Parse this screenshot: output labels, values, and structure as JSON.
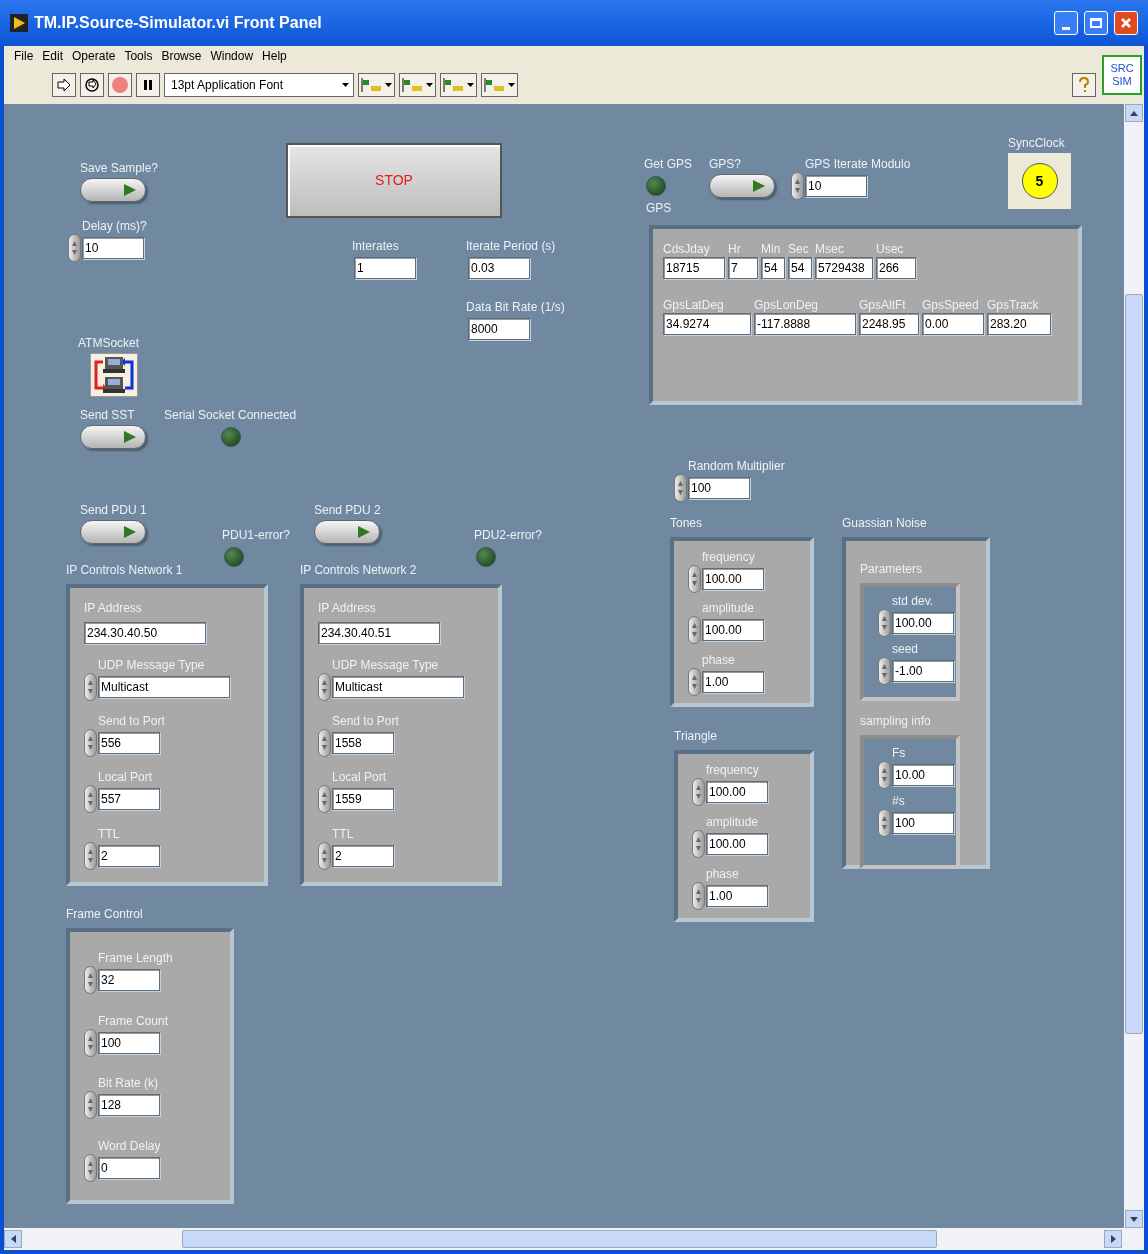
{
  "window": {
    "title": "TM.IP.Source-Simulator.vi Front Panel"
  },
  "menu": [
    "File",
    "Edit",
    "Operate",
    "Tools",
    "Browse",
    "Window",
    "Help"
  ],
  "toolbar": {
    "font": "13pt Application Font"
  },
  "vi_icon": [
    "SRC",
    "SIM"
  ],
  "controls": [
    {
      "kind": "switch",
      "label": "Save Sample?",
      "on": true
    },
    {
      "kind": "button",
      "label": "STOP"
    },
    {
      "kind": "numeric",
      "label": "Delay (ms)?",
      "value": "10"
    },
    {
      "kind": "indicator",
      "label": "Interates",
      "value": "1"
    },
    {
      "kind": "indicator",
      "label": "Iterate Period (s)",
      "value": "0.03"
    },
    {
      "kind": "indicator",
      "label": "Data Bit Rate (1/s)",
      "value": "8000"
    },
    {
      "kind": "socket",
      "label": "ATMSocket"
    },
    {
      "kind": "switch",
      "label": "Send SST",
      "on": true
    },
    {
      "kind": "led",
      "label": "Serial Socket Connected",
      "on": false
    },
    {
      "kind": "switch",
      "label": "Send PDU 1",
      "on": true
    },
    {
      "kind": "led",
      "label": "PDU1-error?",
      "on": false
    },
    {
      "kind": "switch",
      "label": "Send PDU 2",
      "on": true
    },
    {
      "kind": "led",
      "label": "PDU2-error?",
      "on": false
    },
    {
      "kind": "cluster",
      "label": "IP Controls Network 1",
      "children": [
        {
          "kind": "string",
          "label": "IP Address",
          "value": "234.30.40.50"
        },
        {
          "kind": "enum",
          "label": "UDP Message Type",
          "value": "Multicast"
        },
        {
          "kind": "numeric",
          "label": "Send to Port",
          "value": "556"
        },
        {
          "kind": "numeric",
          "label": "Local Port",
          "value": "557"
        },
        {
          "kind": "numeric",
          "label": "TTL",
          "value": "2"
        }
      ]
    },
    {
      "kind": "cluster",
      "label": "IP Controls Network 2",
      "children": [
        {
          "kind": "string",
          "label": "IP Address",
          "value": "234.30.40.51"
        },
        {
          "kind": "enum",
          "label": "UDP Message Type",
          "value": "Multicast"
        },
        {
          "kind": "numeric",
          "label": "Send to Port",
          "value": "1558"
        },
        {
          "kind": "numeric",
          "label": "Local Port",
          "value": "1559"
        },
        {
          "kind": "numeric",
          "label": "TTL",
          "value": "2"
        }
      ]
    },
    {
      "kind": "cluster",
      "label": "Frame Control",
      "children": [
        {
          "kind": "numeric",
          "label": "Frame Length",
          "value": "32"
        },
        {
          "kind": "numeric",
          "label": "Frame Count",
          "value": "100"
        },
        {
          "kind": "numeric",
          "label": "Bit Rate (k)",
          "value": "128"
        },
        {
          "kind": "numeric",
          "label": "Word Delay",
          "value": "0"
        }
      ]
    },
    {
      "kind": "led",
      "label": "Get GPS",
      "caption": "GPS",
      "on": false
    },
    {
      "kind": "switch",
      "label": "GPS?",
      "on": true
    },
    {
      "kind": "numeric",
      "label": "GPS Iterate Modulo",
      "value": "10"
    },
    {
      "kind": "clock",
      "label": "SyncClock",
      "value": "5"
    },
    {
      "kind": "cluster",
      "time_fields": [
        {
          "label": "CdsJday",
          "value": "18715"
        },
        {
          "label": "Hr",
          "value": "7"
        },
        {
          "label": "Min",
          "value": "54"
        },
        {
          "label": "Sec",
          "value": "54"
        },
        {
          "label": "Msec",
          "value": "5729438"
        },
        {
          "label": "Usec",
          "value": "266"
        }
      ],
      "position_fields": [
        {
          "label": "GpsLatDeg",
          "value": "34.9274"
        },
        {
          "label": "GpsLonDeg",
          "value": "-117.8888"
        },
        {
          "label": "GpsAltFt",
          "value": "2248.95"
        },
        {
          "label": "GpsSpeed",
          "value": "0.00"
        },
        {
          "label": "GpsTrack",
          "value": "283.20"
        }
      ]
    },
    {
      "kind": "numeric",
      "label": "Random Multiplier",
      "value": "100"
    },
    {
      "kind": "cluster",
      "label": "Tones",
      "children": [
        {
          "kind": "numeric",
          "label": "frequency",
          "value": "100.00"
        },
        {
          "kind": "numeric",
          "label": "amplitude",
          "value": "100.00"
        },
        {
          "kind": "numeric",
          "label": "phase",
          "value": "1.00"
        }
      ]
    },
    {
      "kind": "cluster",
      "label": "Triangle",
      "children": [
        {
          "kind": "numeric",
          "label": "frequency",
          "value": "100.00"
        },
        {
          "kind": "numeric",
          "label": "amplitude",
          "value": "100.00"
        },
        {
          "kind": "numeric",
          "label": "phase",
          "value": "1.00"
        }
      ]
    },
    {
      "kind": "cluster",
      "label": "Guassian Noise",
      "children": [
        {
          "kind": "cluster",
          "label": "Parameters",
          "children": [
            {
              "kind": "numeric",
              "label": "std dev.",
              "value": "100.00"
            },
            {
              "kind": "numeric",
              "label": "seed",
              "value": "-1.00"
            }
          ]
        },
        {
          "kind": "cluster",
          "label": "sampling info",
          "children": [
            {
              "kind": "numeric",
              "label": "Fs",
              "value": "10.00"
            },
            {
              "kind": "numeric",
              "label": "#s",
              "value": "100"
            }
          ]
        }
      ]
    }
  ]
}
